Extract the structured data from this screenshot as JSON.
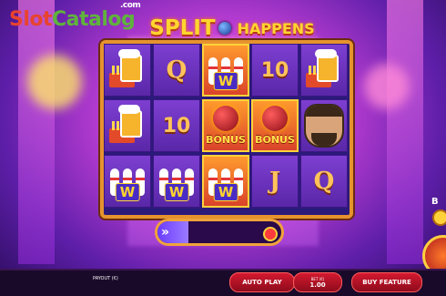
{
  "watermark": {
    "part1": "Slot",
    "part2": "Catalog",
    "part3": ".com"
  },
  "game_logo": {
    "word1": "SPLIT",
    "word2": "HAPPENS"
  },
  "reels": [
    [
      {
        "type": "beer"
      },
      {
        "type": "letter",
        "text": "Q"
      },
      {
        "type": "pins",
        "badge": "W",
        "highlight": true
      },
      {
        "type": "ten",
        "text": "10"
      },
      {
        "type": "beer"
      }
    ],
    [
      {
        "type": "beer"
      },
      {
        "type": "ten",
        "text": "10"
      },
      {
        "type": "bonus",
        "text": "BONUS",
        "highlight": true
      },
      {
        "type": "bonus",
        "text": "BONUS",
        "highlight": true
      },
      {
        "type": "face"
      }
    ],
    [
      {
        "type": "pins",
        "badge": "W"
      },
      {
        "type": "pins",
        "badge": "W"
      },
      {
        "type": "pins",
        "badge": "W",
        "highlight": true
      },
      {
        "type": "letter",
        "text": "J"
      },
      {
        "type": "letter",
        "text": "Q"
      }
    ]
  ],
  "progress": {
    "arrow": "»",
    "fill_fraction": 0.25
  },
  "spin": {
    "label": "B"
  },
  "bottom_bar": {
    "payout_label": "PAYOUT (€)",
    "auto_play": "AUTO PLAY",
    "bet_label": "BET (€)",
    "bet_value": "1.00",
    "buy_feature": "BUY FEATURE"
  }
}
